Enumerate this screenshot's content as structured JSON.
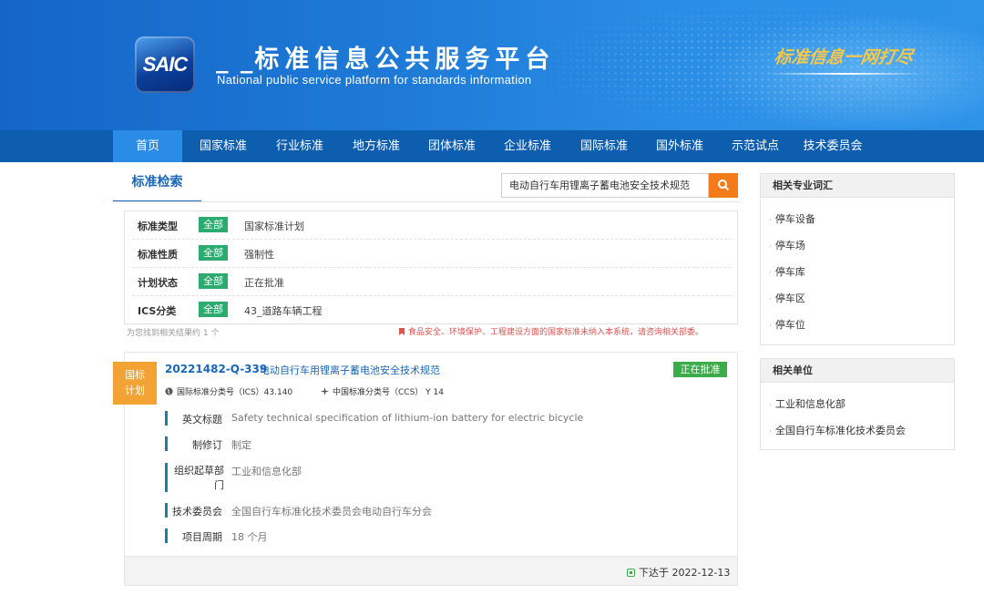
{
  "header": {
    "logo_text": "SAIC",
    "title_prefix": "_ _",
    "title": "标准信息公共服务平台",
    "subtitle": "National public service platform  for standards information",
    "slogan": "标准信息一网打尽"
  },
  "nav": {
    "items": [
      "首页",
      "国家标准",
      "行业标准",
      "地方标准",
      "团体标准",
      "企业标准",
      "国际标准",
      "国外标准",
      "示范试点",
      "技术委员会"
    ],
    "active": "首页"
  },
  "search": {
    "tab_title": "标准检索",
    "query": "电动自行车用锂离子蓄电池安全技术规范",
    "button_icon": "search-icon"
  },
  "filters": [
    {
      "label": "标准类型",
      "all": "全部",
      "value": "国家标准计划"
    },
    {
      "label": "标准性质",
      "all": "全部",
      "value": "强制性"
    },
    {
      "label": "计划状态",
      "all": "全部",
      "value": "正在批准"
    },
    {
      "label": "ICS分类",
      "all": "全部",
      "value": "43_道路车辆工程"
    }
  ],
  "result_count": "为您找到相关结果约 1 个",
  "notice": "食品安全、环境保护、工程建设方面的国家标准未纳入本系统，请咨询相关部委。",
  "result": {
    "type_badge_line1": "国标",
    "type_badge_line2": "计划",
    "plan_no": "20221482-Q-339",
    "name": "电动自行车用锂离子蓄电池安全技术规范",
    "status": "正在批准",
    "ics": "国际标准分类号（ICS）43.140",
    "ccs": "中国标准分类号（CCS） Y 14",
    "details": [
      {
        "label": "英文标题",
        "value": "Safety technical specification of lithium-ion battery for electric bicycle"
      },
      {
        "label": "制修订",
        "value": "制定"
      },
      {
        "label": "组织起草部门",
        "value": "工业和信息化部"
      },
      {
        "label": "技术委员会",
        "value": "全国自行车标准化技术委员会电动自行车分会"
      },
      {
        "label": "项目周期",
        "value": "18 个月"
      }
    ],
    "issue_date": "下达于 2022-12-13"
  },
  "sidebar": {
    "vocab_title": "相关专业词汇",
    "vocab": [
      "停车设备",
      "停车场",
      "停车库",
      "停车区",
      "停车位"
    ],
    "units_title": "相关单位",
    "units": [
      "工业和信息化部",
      "全国自行车标准化技术委员会"
    ]
  },
  "colors": {
    "header_blue": "#1e7ad6",
    "nav_blue": "#0e5eaf",
    "nav_active": "#2a8ce6",
    "filter_green": "#2bab6f",
    "status_green": "#3aac4a",
    "badge_orange": "#f2a334",
    "search_orange": "#f27c1a"
  }
}
